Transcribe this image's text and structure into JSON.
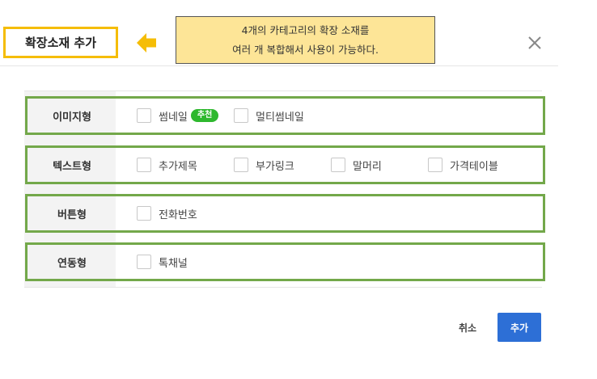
{
  "header": {
    "title": "확장소재 추가",
    "callout_line1": "4개의 카테고리의 확장 소재를",
    "callout_line2": "여러 개 복합해서 사용이 가능하다.",
    "close_icon": "close-icon",
    "arrow_icon": "arrow-left-icon"
  },
  "colors": {
    "title_border": "#f5bd06",
    "arrow": "#f5bd06",
    "callout_bg": "#fde597",
    "row_border": "#73a84a",
    "badge": "#2eb82e",
    "primary": "#2d6fd6"
  },
  "rows": [
    {
      "label": "이미지형",
      "options": [
        {
          "label": "썸네일",
          "badge": "추천",
          "checked": false
        },
        {
          "label": "멀티썸네일",
          "checked": false
        }
      ]
    },
    {
      "label": "텍스트형",
      "options": [
        {
          "label": "추가제목",
          "checked": false
        },
        {
          "label": "부가링크",
          "checked": false
        },
        {
          "label": "말머리",
          "checked": false
        },
        {
          "label": "가격테이블",
          "checked": false
        }
      ]
    },
    {
      "label": "버튼형",
      "options": [
        {
          "label": "전화번호",
          "checked": false
        }
      ]
    },
    {
      "label": "연동형",
      "options": [
        {
          "label": "톡채널",
          "checked": false
        }
      ]
    }
  ],
  "footer": {
    "cancel_label": "취소",
    "add_label": "추가"
  }
}
